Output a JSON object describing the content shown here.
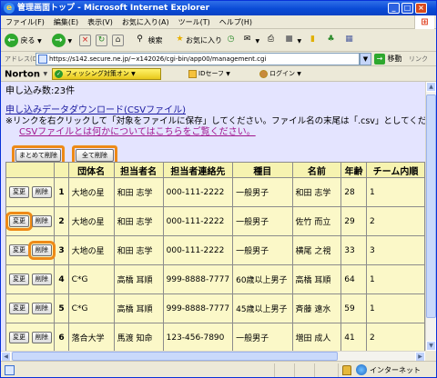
{
  "window": {
    "title": "管理画面トップ - Microsoft Internet Explorer"
  },
  "menu": [
    "ファイル(F)",
    "編集(E)",
    "表示(V)",
    "お気に入り(A)",
    "ツール(T)",
    "ヘルプ(H)"
  ],
  "toolbar": {
    "back_label": "戻る",
    "search_label": "検索",
    "favorites_label": "お気に入り"
  },
  "address": {
    "label": "アドレス(D)",
    "url": "https://s142.secure.ne.jp/~x142026/cgi-bin/app00/management.cgi",
    "go_label": "移動",
    "links_label": "リンク"
  },
  "norton": {
    "brand": "Norton",
    "phishing_label": "フィッシング対策オン",
    "idsafe_label": "IDセーフ",
    "login_label": "ログイン"
  },
  "page": {
    "count_text": "申し込み数:23件",
    "csv_link": "申し込みデータダウンロード(CSVファイル)",
    "instruction": "※リンクを右クリックして「対象をファイルに保存」してください。ファイル名の末尾は「.csv」としてください。",
    "csv_help_link": "CSVファイルとは何かについてはこちらをご覧ください。",
    "bulk_delete_label": "まとめて削除",
    "delete_all_label": "全て削除",
    "edit_label": "変更",
    "delete_label": "削除"
  },
  "table": {
    "headers": [
      "",
      "",
      "団体名",
      "担当者名",
      "担当者連絡先",
      "種目",
      "名前",
      "年齢",
      "チーム内順"
    ],
    "rows": [
      {
        "no": "1",
        "org": "大地の星",
        "contact_name": "和田 志学",
        "phone": "000-111-2222",
        "event": "一般男子",
        "name": "和田 志学",
        "age": "28",
        "order": "1"
      },
      {
        "no": "2",
        "org": "大地の星",
        "contact_name": "和田 志学",
        "phone": "000-111-2222",
        "event": "一般男子",
        "name": "佐竹 而立",
        "age": "29",
        "order": "2"
      },
      {
        "no": "3",
        "org": "大地の星",
        "contact_name": "和田 志学",
        "phone": "000-111-2222",
        "event": "一般男子",
        "name": "横尾 之視",
        "age": "33",
        "order": "3"
      },
      {
        "no": "4",
        "org": "C*G",
        "contact_name": "高橋 耳順",
        "phone": "999-8888-7777",
        "event": "60歳以上男子",
        "name": "高橋 耳順",
        "age": "64",
        "order": "1"
      },
      {
        "no": "5",
        "org": "C*G",
        "contact_name": "高橋 耳順",
        "phone": "999-8888-7777",
        "event": "45歳以上男子",
        "name": "斉藤 遠水",
        "age": "59",
        "order": "1"
      },
      {
        "no": "6",
        "org": "落合大学",
        "contact_name": "馬渡 知命",
        "phone": "123-456-7890",
        "event": "一般男子",
        "name": "増田 成人",
        "age": "41",
        "order": "2"
      }
    ]
  },
  "status": {
    "zone_label": "インターネット"
  },
  "colors": {
    "highlight": "#ee8a17",
    "page_bg": "#e4e4ff",
    "table_row": "#fbf8c8",
    "table_header": "#f6f3b0"
  }
}
